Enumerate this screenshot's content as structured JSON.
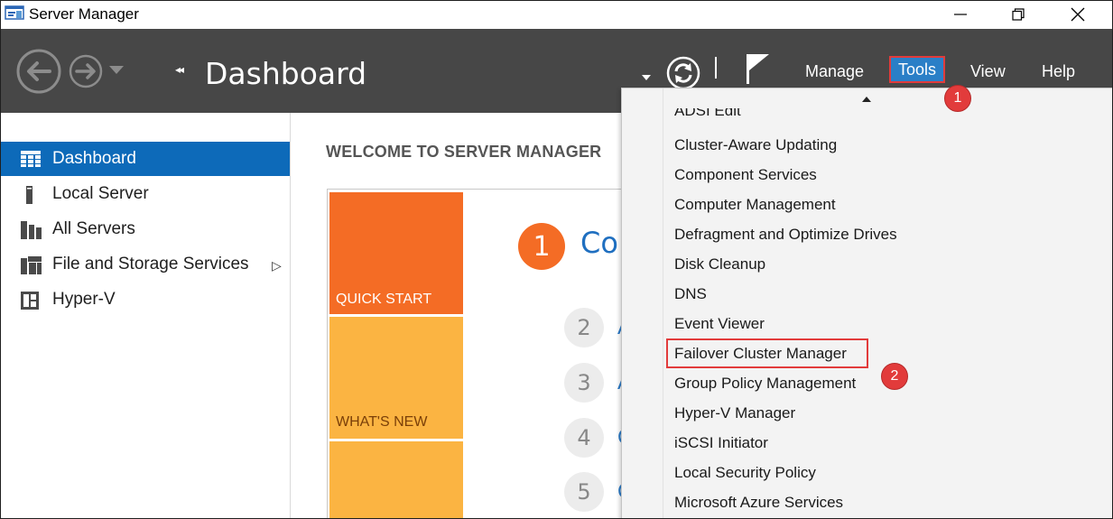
{
  "window": {
    "title": "Server Manager"
  },
  "header": {
    "breadcrumb_arrows": "◂◂",
    "page_title": "Dashboard",
    "menus": {
      "manage": "Manage",
      "tools": "Tools",
      "view": "View",
      "help": "Help"
    }
  },
  "sidebar": {
    "items": [
      {
        "label": "Dashboard",
        "icon": "dashboard-icon",
        "active": true
      },
      {
        "label": "Local Server",
        "icon": "server-icon"
      },
      {
        "label": "All Servers",
        "icon": "servers-icon"
      },
      {
        "label": "File and Storage Services",
        "icon": "file-storage-icon",
        "expander": "▷"
      },
      {
        "label": "Hyper-V",
        "icon": "hyperv-icon"
      }
    ]
  },
  "main": {
    "welcome_title": "WELCOME TO SERVER MANAGER",
    "tiles": {
      "quick_start": "QUICK START",
      "whats_new": "WHAT'S NEW"
    },
    "steps": [
      {
        "num": "1",
        "text": "Co"
      },
      {
        "num": "2",
        "text": "A"
      },
      {
        "num": "3",
        "text": "A"
      },
      {
        "num": "4",
        "text": "C"
      },
      {
        "num": "5",
        "text": "C"
      }
    ]
  },
  "tools_menu": {
    "items": [
      "ADSI Edit",
      "Cluster-Aware Updating",
      "Component Services",
      "Computer Management",
      "Defragment and Optimize Drives",
      "Disk Cleanup",
      "DNS",
      "Event Viewer",
      "Failover Cluster Manager",
      "Group Policy Management",
      "Hyper-V Manager",
      "iSCSI Initiator",
      "Local Security Policy",
      "Microsoft Azure Services"
    ],
    "highlighted": "Failover Cluster Manager"
  },
  "annotations": {
    "badge_1": "1",
    "badge_2": "2"
  },
  "colors": {
    "header_bg": "#474747",
    "active_blue": "#0d6ab9",
    "quick_start_orange": "#f46c25",
    "whats_new_yellow": "#fbb442",
    "annotation_red": "#e23b3b"
  }
}
